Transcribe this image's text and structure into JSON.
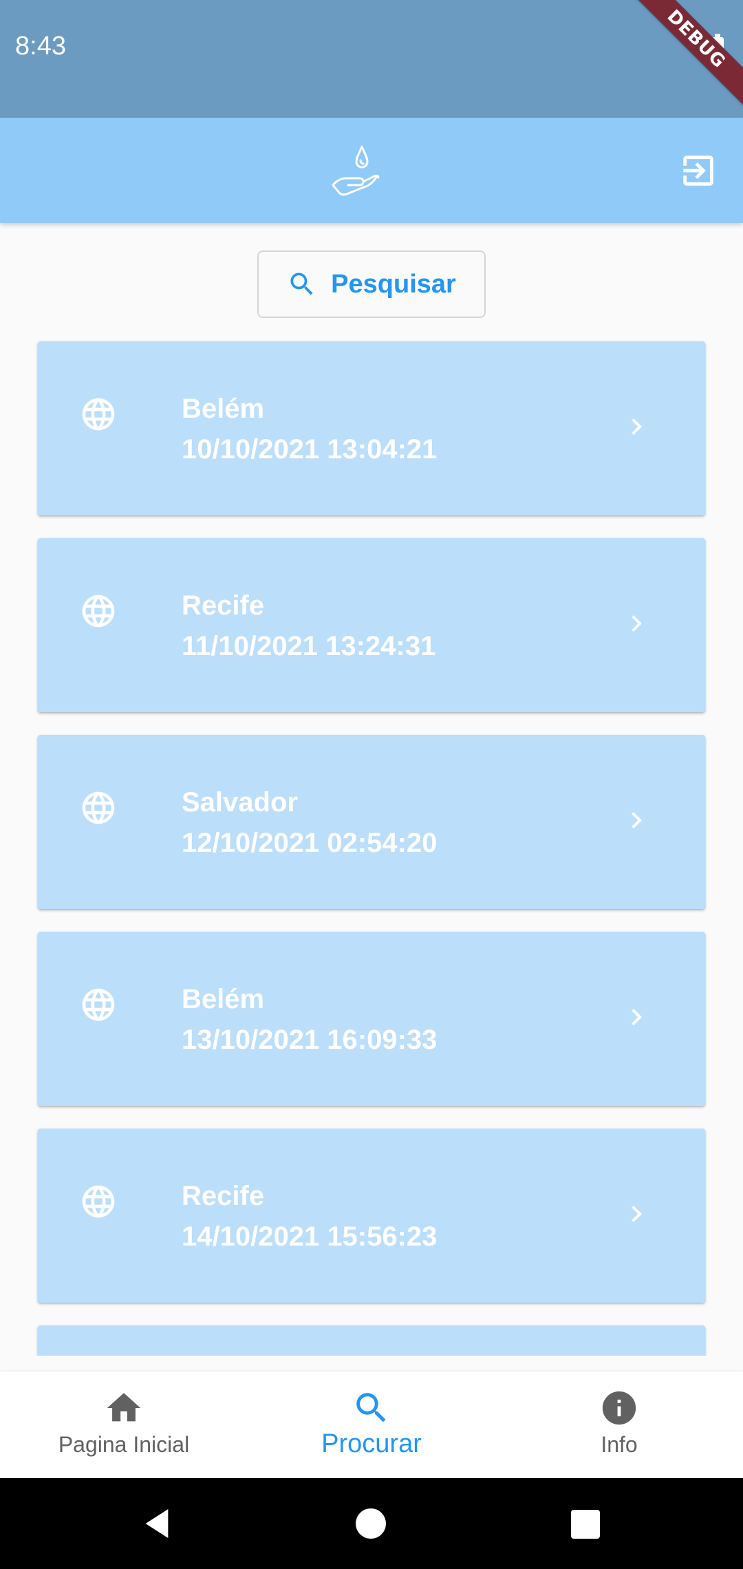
{
  "status_bar": {
    "time": "8:43",
    "battery_icon": "battery-full-icon",
    "debug_banner": "DEBUG"
  },
  "app_bar": {
    "logo_icon": "hand-water-drop-icon",
    "logout_icon": "exit-to-app-icon",
    "background": "#90caf9"
  },
  "search": {
    "label": "Pesquisar",
    "icon": "search-icon",
    "accent": "#2196f3"
  },
  "items": [
    {
      "city": "Belém",
      "datetime": "10/10/2021 13:04:21"
    },
    {
      "city": "Recife",
      "datetime": "11/10/2021 13:24:31"
    },
    {
      "city": "Salvador",
      "datetime": "12/10/2021 02:54:20"
    },
    {
      "city": "Belém",
      "datetime": "13/10/2021 16:09:33"
    },
    {
      "city": "Recife",
      "datetime": "14/10/2021 15:56:23"
    }
  ],
  "card_style": {
    "background": "#bbdefb",
    "icon": "globe-icon",
    "trailing_icon": "chevron-right-icon"
  },
  "bottom_nav": {
    "items": [
      {
        "label": "Pagina Inicial",
        "icon": "home-icon",
        "active": false
      },
      {
        "label": "Procurar",
        "icon": "search-icon",
        "active": true
      },
      {
        "label": "Info",
        "icon": "info-icon",
        "active": false
      }
    ]
  }
}
